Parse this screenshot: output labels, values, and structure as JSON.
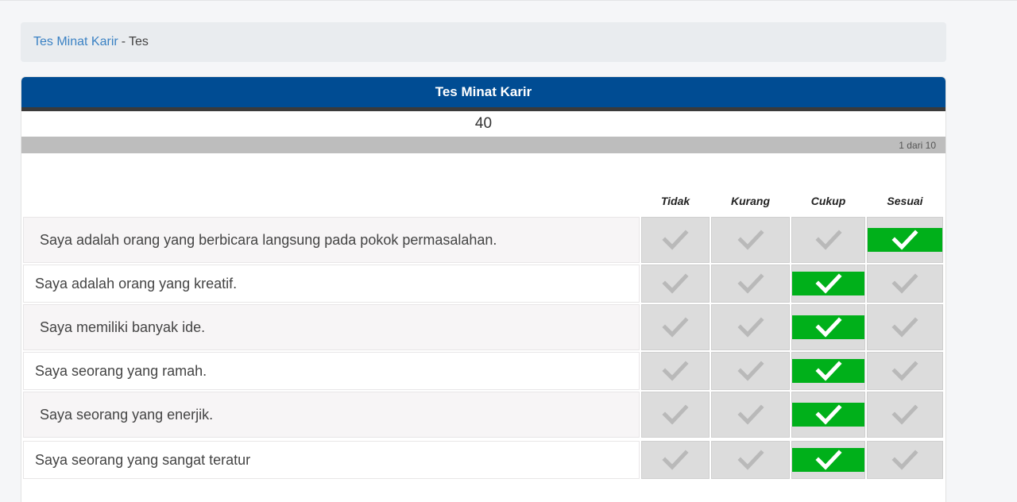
{
  "breadcrumb": {
    "link": "Tes Minat Karir",
    "separator": "-",
    "current": "Tes"
  },
  "card": {
    "title": "Tes Minat Karir"
  },
  "timer": {
    "value": "40"
  },
  "progress": {
    "label": "1 dari 10",
    "fraction": 0.1
  },
  "columns": [
    "Tidak",
    "Kurang",
    "Cukup",
    "Sesuai"
  ],
  "questions": [
    {
      "text": "Saya adalah orang yang berbicara langsung pada pokok permasalahan.",
      "selected": 3
    },
    {
      "text": "Saya adalah orang yang kreatif.",
      "selected": 2
    },
    {
      "text": "Saya memiliki banyak ide.",
      "selected": 2
    },
    {
      "text": "Saya seorang yang ramah.",
      "selected": 2
    },
    {
      "text": "Saya seorang yang enerjik.",
      "selected": 2
    },
    {
      "text": "Saya seorang yang sangat teratur",
      "selected": 2
    }
  ],
  "colors": {
    "header": "#004c93",
    "selected": "#00b01a",
    "unselected": "#dcdcdc",
    "link": "#3b82c4"
  },
  "icons": {
    "option": "check-icon"
  }
}
